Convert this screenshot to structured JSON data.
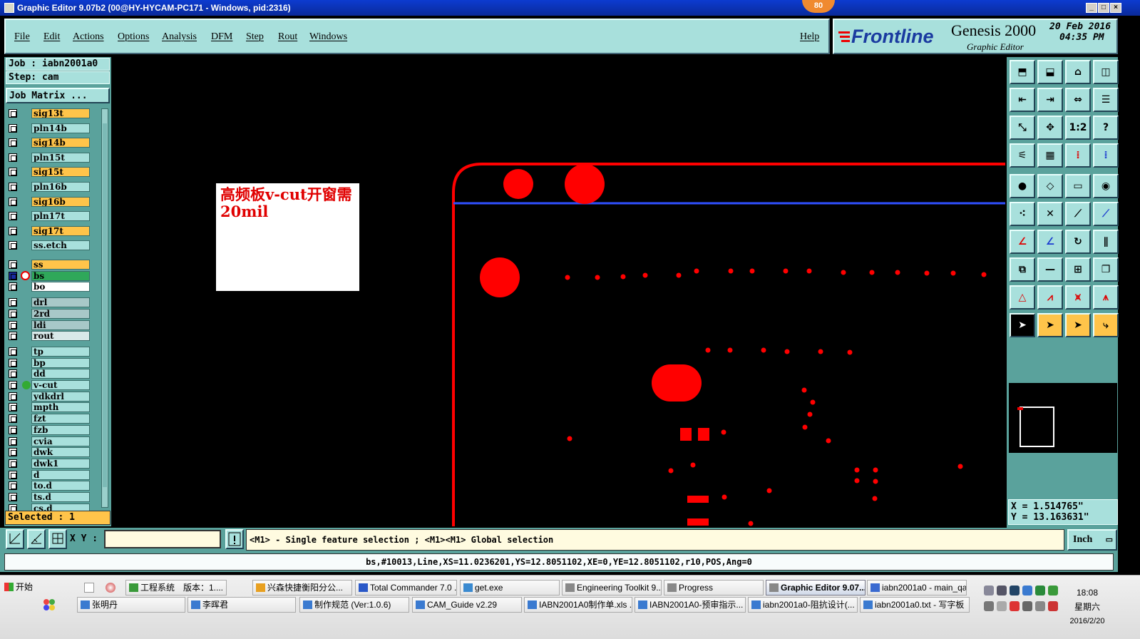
{
  "window": {
    "title": "Graphic Editor 9.07b2 (00@HY-HYCAM-PC171 - Windows, pid:2316)",
    "badge": "80"
  },
  "menu": {
    "items": [
      "File",
      "Edit",
      "Actions",
      "Options",
      "Analysis",
      "DFM",
      "Step",
      "Rout",
      "Windows"
    ],
    "help": "Help"
  },
  "brand": {
    "logo": "Frontline",
    "product": "Genesis 2000",
    "subtitle": "Graphic Editor",
    "date": "20 Feb 2016",
    "time": "04:35 PM"
  },
  "job": {
    "job_label": "Job : iabn2001a0",
    "step_label": "Step: cam",
    "matrix_button": "Job Matrix ...",
    "selected": "Selected : 1"
  },
  "layers": [
    {
      "name": "sig13t",
      "color": "y"
    },
    {
      "name": "pln14b",
      "color": "c"
    },
    {
      "name": "sig14b",
      "color": "y"
    },
    {
      "name": "pln15t",
      "color": "c"
    },
    {
      "name": "sig15t",
      "color": "y"
    },
    {
      "name": "pln16b",
      "color": "c"
    },
    {
      "name": "sig16b",
      "color": "y"
    },
    {
      "name": "pln17t",
      "color": "c"
    },
    {
      "name": "sig17t",
      "color": "y"
    },
    {
      "name": "ss.etch",
      "color": "c"
    },
    {
      "name": "ss",
      "color": "y"
    },
    {
      "name": "bs",
      "color": "g"
    },
    {
      "name": "bo",
      "color": "w"
    },
    {
      "name": "drl",
      "color": "s"
    },
    {
      "name": "2rd",
      "color": "s"
    },
    {
      "name": "ldi",
      "color": "s"
    },
    {
      "name": "rout",
      "color": "l"
    },
    {
      "name": "tp",
      "color": "c"
    },
    {
      "name": "bp",
      "color": "c"
    },
    {
      "name": "dd",
      "color": "c"
    },
    {
      "name": "v-cut",
      "color": "c"
    },
    {
      "name": "ydkdrl",
      "color": "c"
    },
    {
      "name": "mpth",
      "color": "c"
    },
    {
      "name": "fzt",
      "color": "c"
    },
    {
      "name": "fzb",
      "color": "c"
    },
    {
      "name": "cvia",
      "color": "c"
    },
    {
      "name": "dwk",
      "color": "c"
    },
    {
      "name": "dwk1",
      "color": "c"
    },
    {
      "name": "d",
      "color": "c"
    },
    {
      "name": "to.d",
      "color": "c"
    },
    {
      "name": "ts.d",
      "color": "c"
    },
    {
      "name": "cs.d",
      "color": "c"
    }
  ],
  "canvas": {
    "note_text": "高频板v-cut开窗需20mil",
    "feature_color": "#ff0000",
    "line_color": "#3050ff"
  },
  "coords": {
    "x": "X = 1.514765\"",
    "y": "Y = 13.163631\""
  },
  "bottom": {
    "xy_label": "X Y :",
    "xy_value": "",
    "message": "<M1> - Single feature selection ; <M1><M1> Global selection",
    "unit": "Inch",
    "status": "bs,#10013,Line,XS=11.0236201,YS=12.8051102,XE=0,YE=12.8051102,r10,POS,Ang=0"
  },
  "taskbar": {
    "start": "开始",
    "row1": [
      "工程系统　版本：1....",
      "兴森快捷衡阳分公...",
      "Total Commander 7.0 ...",
      "get.exe",
      "Engineering Toolkit 9....",
      "Progress",
      "Graphic Editor 9.07...",
      "iabn2001a0 - main_qa"
    ],
    "row2": [
      "张明丹",
      "李晖君",
      "制作规范 (Ver:1.0.6)",
      "CAM_Guide v2.29",
      "IABN2001A0制作单.xls ...",
      "IABN2001A0-预审指示...",
      "iabn2001a0-阻抗设计(...",
      "iabn2001a0.txt - 写字板"
    ],
    "clock_time": "18:08",
    "clock_day": "星期六",
    "clock_date": "2016/2/20"
  }
}
